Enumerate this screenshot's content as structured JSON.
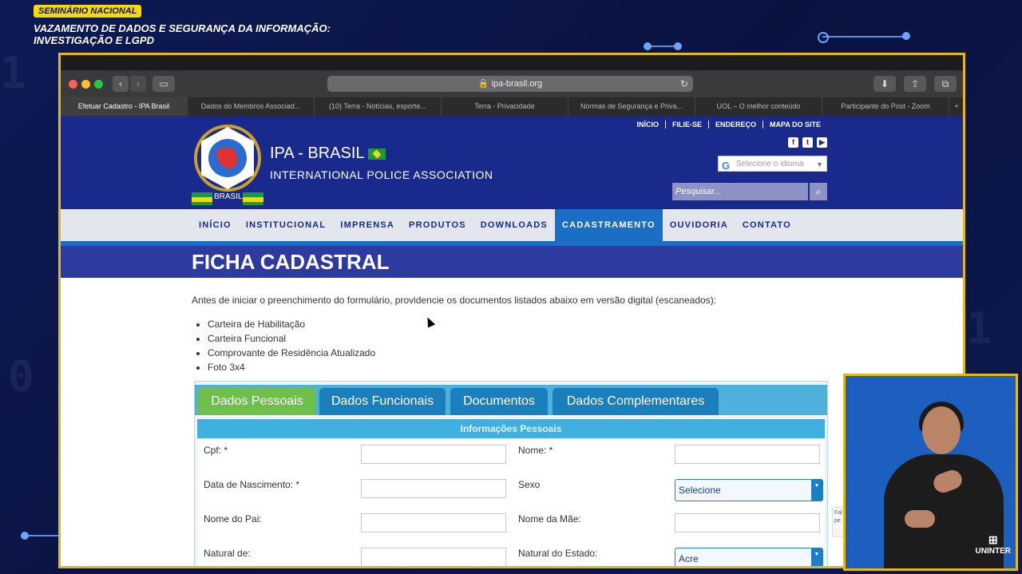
{
  "overlay": {
    "badge": "SEMINÁRIO NACIONAL",
    "title": "VAZAMENTO DE DADOS E SEGURANÇA DA INFORMAÇÃO: INVESTIGAÇÃO E LGPD",
    "brand": "UNINTER"
  },
  "browser": {
    "url": "ipa-brasil.org",
    "tabs": [
      {
        "label": "Efetuar Cadastro - IPA Brasil",
        "active": true
      },
      {
        "label": "Dados do Membros Associad..."
      },
      {
        "label": "(10) Terra - Notícias, esporte..."
      },
      {
        "label": "Terra - Privacidade"
      },
      {
        "label": "Normas de Segurança e Priva..."
      },
      {
        "label": "UOL – O melhor conteúdo"
      },
      {
        "label": "Participante do Post - Zoom"
      }
    ],
    "new_tab": "+"
  },
  "header": {
    "site_name": "IPA - BRASIL",
    "site_subtitle": "INTERNATIONAL POLICE ASSOCIATION",
    "logo_text": "BRASIL",
    "top_links": [
      "INÍCIO",
      "FILIE-SE",
      "ENDEREÇO",
      "MAPA DO SITE"
    ],
    "language_placeholder": "Selecione o idioma",
    "search_placeholder": "Pesquisar..."
  },
  "nav": {
    "items": [
      "INÍCIO",
      "INSTITUCIONAL",
      "IMPRENSA",
      "PRODUTOS",
      "DOWNLOADS",
      "CADASTRAMENTO",
      "OUVIDORIA",
      "CONTATO"
    ],
    "active": "CADASTRAMENTO"
  },
  "page": {
    "title": "FICHA CADASTRAL",
    "intro": "Antes de iniciar o preenchimento do formulário, providencie os documentos listados abaixo em versão digital (escaneados):",
    "documents": [
      "Carteira de Habilitação",
      "Carteira Funcional",
      "Comprovante de Residência Atualizado",
      "Foto 3x4"
    ]
  },
  "form": {
    "tabs": [
      "Dados Pessoais",
      "Dados Funcionais",
      "Documentos",
      "Dados Complementares"
    ],
    "active_tab": "Dados Pessoais",
    "section": "Informações Pessoais",
    "fields": {
      "cpf": "Cpf:  *",
      "nome": "Nome:  *",
      "nascimento": "Data de Nascimento: *",
      "sexo": "Sexo",
      "sexo_value": "Selecione",
      "pai": "Nome do Pai:",
      "mae": "Nome da Mãe:",
      "natural": "Natural de:",
      "estado": "Natural do Estado:",
      "estado_value": "Acre"
    },
    "side_note": "Fal pe"
  }
}
